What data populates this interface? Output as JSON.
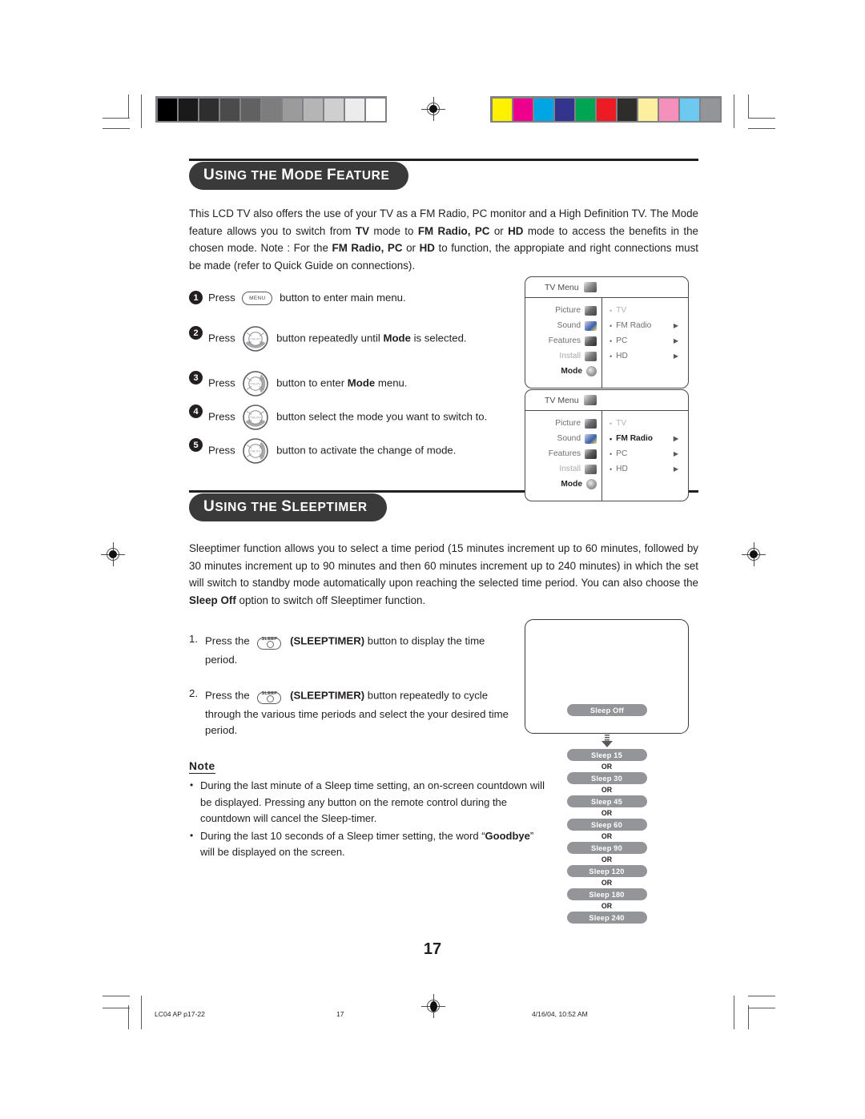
{
  "page": {
    "number": "17",
    "footer": {
      "file": "LC04 AP p17-22",
      "page": "17",
      "timestamp": "4/16/04, 10:52 AM"
    }
  },
  "print_marks": {
    "grayscale_patches": [
      "#000000",
      "#1a1a1a",
      "#2e2e2e",
      "#4b4b4b",
      "#616161",
      "#7d7d7d",
      "#9b9b9b",
      "#b5b5b5",
      "#cfcfcf",
      "#ececec",
      "#ffffff"
    ],
    "color_patches": [
      "#fff200",
      "#ec008c",
      "#00a5e3",
      "#33348e",
      "#00a554",
      "#ed1c24",
      "#2e2d2c",
      "#fcf0a0",
      "#f490bb",
      "#6ec9f0",
      "#939598"
    ]
  },
  "sections": [
    {
      "id": "mode",
      "title_cap": "U",
      "title_rest_1": "SING THE ",
      "title_cap_2": "M",
      "title_rest_2": "ODE ",
      "title_cap_3": "F",
      "title_rest_3": "EATURE",
      "title_plain": "Using the Mode Feature"
    }
  ],
  "mode_section": {
    "heading": {
      "u": "U",
      "sing_the": "SING THE ",
      "m": "M",
      "ode": "ODE ",
      "f": "F",
      "eature": "EATURE"
    },
    "intro_part1": "This LCD TV also offers the use of your TV as a FM Radio, PC monitor and a High Definition TV. The Mode feature allows you to switch from ",
    "intro_b1": "TV",
    "intro_part2": " mode to ",
    "intro_b2": "FM Radio, PC",
    "intro_part3": " or ",
    "intro_b3": "HD",
    "intro_part4": " mode to access the benefits in the chosen mode. Note : For the ",
    "intro_b4": "FM Radio, PC",
    "intro_part5": " or ",
    "intro_b5": "HD",
    "intro_part6": " to function, the appropiate and right connections must be made (refer to Quick Guide on connections).",
    "steps": [
      {
        "num": "1",
        "before": "Press",
        "key": "MENU",
        "key_type": "menu",
        "after": "button to enter main menu.",
        "bold": "",
        "after2": ""
      },
      {
        "num": "2",
        "before": "Press",
        "key": "cursor-down",
        "key_type": "nav-down",
        "after": "button repeatedly until ",
        "bold": "Mode",
        "after2": " is selected."
      },
      {
        "num": "3",
        "before": "Press",
        "key": "cursor-right",
        "key_type": "nav-right",
        "after": "button to enter ",
        "bold": "Mode",
        "after2": " menu."
      },
      {
        "num": "4",
        "before": "Press",
        "key": "cursor-down",
        "key_type": "nav-down",
        "after": "button select the mode you want to switch to.",
        "bold": "",
        "after2": ""
      },
      {
        "num": "5",
        "before": "Press",
        "key": "cursor-right",
        "key_type": "nav-right",
        "after": "button to activate the change of mode.",
        "bold": "",
        "after2": ""
      }
    ]
  },
  "osd_menus": [
    {
      "title": "TV Menu",
      "left_items": [
        {
          "label": "Picture",
          "icon": "picture-icon",
          "state": "normal"
        },
        {
          "label": "Sound",
          "icon": "sound-icon",
          "state": "normal"
        },
        {
          "label": "Features",
          "icon": "features-icon",
          "state": "normal"
        },
        {
          "label": "Install",
          "icon": "install-icon",
          "state": "dim"
        },
        {
          "label": "Mode",
          "icon": "mode-icon",
          "state": "selected"
        }
      ],
      "right_items": [
        {
          "label": "TV",
          "state": "dim",
          "arrow": false
        },
        {
          "label": "FM Radio",
          "state": "normal",
          "arrow": true
        },
        {
          "label": "PC",
          "state": "normal",
          "arrow": true
        },
        {
          "label": "HD",
          "state": "normal",
          "arrow": true
        }
      ]
    },
    {
      "title": "TV Menu",
      "left_items": [
        {
          "label": "Picture",
          "icon": "picture-icon",
          "state": "normal"
        },
        {
          "label": "Sound",
          "icon": "sound-icon",
          "state": "normal"
        },
        {
          "label": "Features",
          "icon": "features-icon",
          "state": "normal"
        },
        {
          "label": "Install",
          "icon": "install-icon",
          "state": "dim"
        },
        {
          "label": "Mode",
          "icon": "mode-icon",
          "state": "selected"
        }
      ],
      "right_items": [
        {
          "label": "TV",
          "state": "dim",
          "arrow": false
        },
        {
          "label": "FM Radio",
          "state": "selected",
          "arrow": true
        },
        {
          "label": "PC",
          "state": "normal",
          "arrow": true
        },
        {
          "label": "HD",
          "state": "normal",
          "arrow": true
        }
      ]
    }
  ],
  "sleeptimer_section": {
    "heading": {
      "u": "U",
      "sing_the": "SING THE ",
      "s": "S",
      "leeptimer": "LEEPTIMER"
    },
    "intro_part1": "Sleeptimer function allows you to select a time period (15 minutes increment up to 60 minutes, followed by 30 minutes increment up to 90 minutes and then 60 minutes increment up to 240 minutes) in which the set will switch to standby mode automatically upon reaching the selected time period. You can also choose the ",
    "intro_b1": "Sleep Off",
    "intro_part2": " option to switch off Sleeptimer function.",
    "steps": [
      {
        "num": "1.",
        "before": "Press the",
        "key_label": "SLEEP",
        "bold": "(SLEEPTIMER)",
        "after": " button to display the time period."
      },
      {
        "num": "2.",
        "before": "Press the",
        "key_label": "SLEEP",
        "bold": "(SLEEPTIMER)",
        "after": " button repeatedly to cycle through the various time periods and select the your desired time period."
      }
    ],
    "note_heading": "Note",
    "notes": [
      {
        "text": "During the last minute of a Sleep time setting, an on-screen countdown will be displayed. Pressing any button on the remote control during the countdown will cancel the Sleep-timer.",
        "bold_word": "",
        "tail": ""
      },
      {
        "text": "During the last 10 seconds of a Sleep timer setting,  the word “",
        "bold_word": "Goodbye",
        "tail": "” will be displayed on the screen."
      }
    ],
    "flow": {
      "screen_button": "Sleep Off",
      "or_label": "OR",
      "options": [
        "Sleep 15",
        "Sleep 30",
        "Sleep 45",
        "Sleep 60",
        "Sleep 90",
        "Sleep 120",
        "Sleep 180",
        "Sleep 240"
      ]
    }
  }
}
